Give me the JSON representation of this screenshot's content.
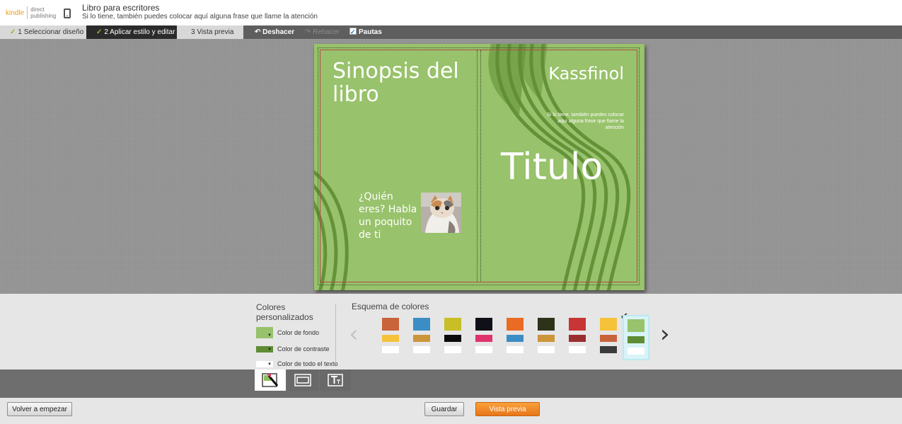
{
  "header": {
    "logo_kindle": "kindle",
    "logo_line1": "direct",
    "logo_line2": "publishing",
    "project_title": "Libro para escritores",
    "project_subtitle": "Si lo tiene, también puedes colocar aquí alguna frase que llame la atención"
  },
  "steps": [
    {
      "label": "1 Seleccionar diseño",
      "done": true
    },
    {
      "label": "2 Aplicar estilo y editar",
      "done": true,
      "active": true
    },
    {
      "label": "3 Vista previa",
      "done": false
    }
  ],
  "toolbar": {
    "undo_label": "Deshacer",
    "redo_label": "Rehacer",
    "guides_label": "Pautas",
    "guides_checked": true
  },
  "cover": {
    "synopsis_title": "Sinopsis del libro",
    "author": "Kassfinol",
    "tagline": "Si lo tiene, también puedes colocar aquí alguna frase que llame la atención",
    "title": "Titulo",
    "about_text": "¿Quién eres? Habla un poquito de ti",
    "background_color": "#98c26b",
    "stripe_color": "#5f8d33"
  },
  "custom_colors": {
    "heading": "Colores personalizados",
    "items": [
      {
        "label": "Color de fondo",
        "color": "#98c26b"
      },
      {
        "label": "Color de contraste",
        "color": "#5f8d33"
      },
      {
        "label": "Color de todo el texto",
        "color": "#ffffff"
      }
    ]
  },
  "schemes": {
    "heading": "Esquema de colores",
    "selected_index": 8,
    "items": [
      {
        "c1": "#c8633a",
        "c2": "#f5c23a",
        "c3": "#ffffff"
      },
      {
        "c1": "#3b8ec4",
        "c2": "#cc953a",
        "c3": "#ffffff"
      },
      {
        "c1": "#c7bf25",
        "c2": "#0b0b0b",
        "c3": "#ffffff"
      },
      {
        "c1": "#101018",
        "c2": "#e0336e",
        "c3": "#ffffff"
      },
      {
        "c1": "#ea6b23",
        "c2": "#3b8ec4",
        "c3": "#ffffff"
      },
      {
        "c1": "#2d3319",
        "c2": "#cc953a",
        "c3": "#ffffff"
      },
      {
        "c1": "#c83535",
        "c2": "#9a2e2e",
        "c3": "#ffffff"
      },
      {
        "c1": "#f5c23a",
        "c2": "#c8633a",
        "c3": "#3a3a3a"
      },
      {
        "c1": "#98c26b",
        "c2": "#5f8d33",
        "c3": "#ffffff"
      }
    ]
  },
  "tabs": [
    {
      "icon": "paint-palette-icon"
    },
    {
      "icon": "layout-icon"
    },
    {
      "icon": "text-icon"
    }
  ],
  "footer": {
    "restart_label": "Volver a empezar",
    "save_label": "Guardar",
    "preview_label": "Vista previa"
  }
}
